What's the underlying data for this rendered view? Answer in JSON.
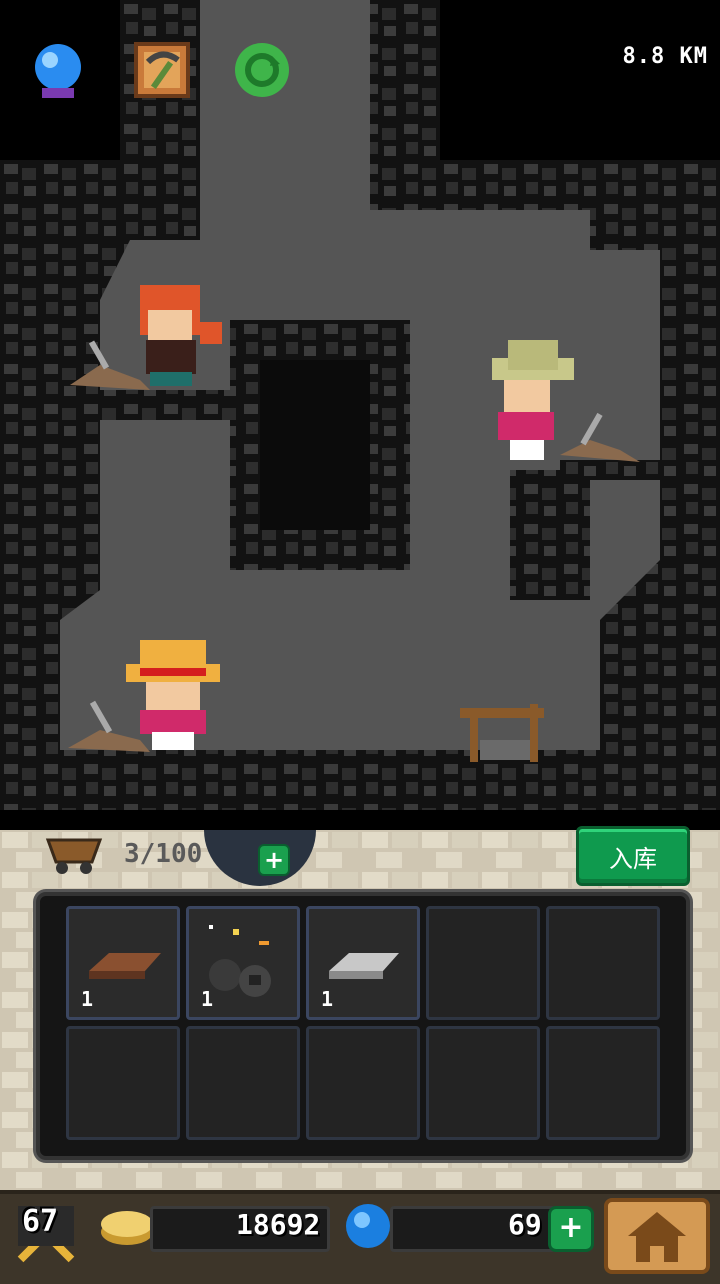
{
  "hud": {
    "distance": "8.8 KM",
    "top_icons": [
      "crystal-ball-icon",
      "pickaxe-card-icon",
      "refresh-icon"
    ]
  },
  "storage": {
    "capacity": "3/100",
    "store_button": "入库"
  },
  "inventory": [
    {
      "item": "wood-plank-icon",
      "count": "1"
    },
    {
      "item": "coal-ore-icon",
      "count": "1"
    },
    {
      "item": "iron-ingot-icon",
      "count": "1"
    },
    {
      "item": "",
      "count": ""
    },
    {
      "item": "",
      "count": ""
    },
    {
      "item": "",
      "count": ""
    },
    {
      "item": "",
      "count": ""
    },
    {
      "item": "",
      "count": ""
    },
    {
      "item": "",
      "count": ""
    },
    {
      "item": "",
      "count": ""
    }
  ],
  "footer": {
    "level": "67",
    "gold": "18692",
    "gems": "69"
  },
  "colors": {
    "cave_floor": "#555555",
    "rock": "#2b2b2b",
    "store_green": "#0f9a4e",
    "gem_blue": "#1b7fe0",
    "gold": "#e7c25a"
  }
}
